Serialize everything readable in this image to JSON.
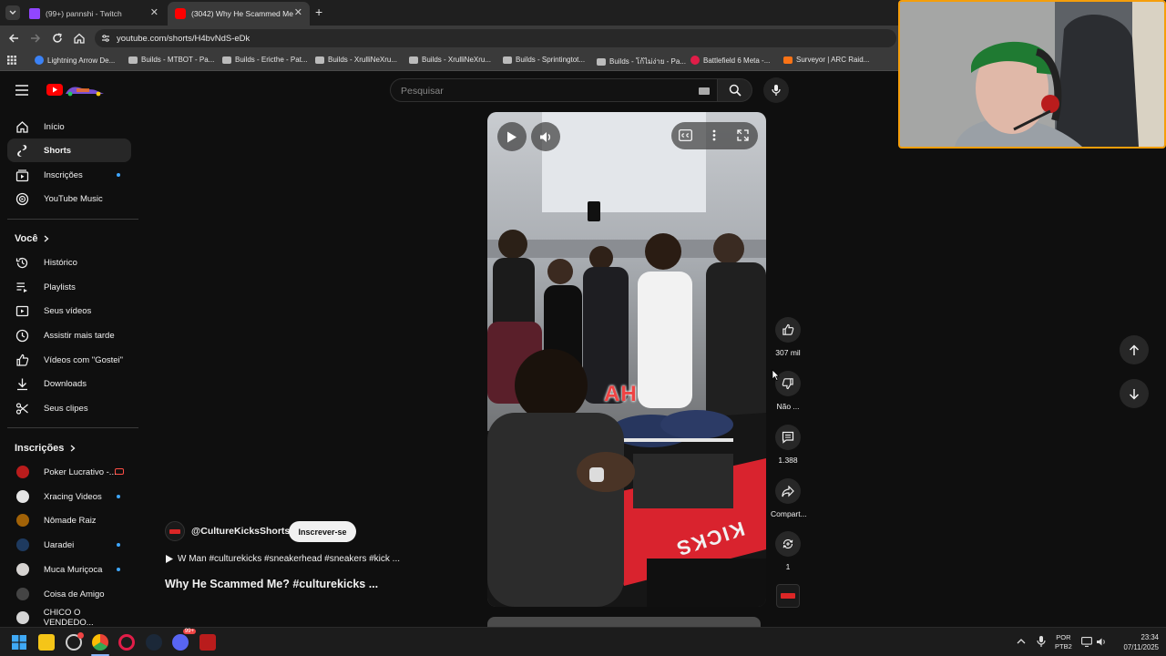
{
  "browser": {
    "tabs": [
      {
        "title": "(99+) pannshi - Twitch"
      },
      {
        "title": "(3042) Why He Scammed Me? #"
      }
    ],
    "url": "youtube.com/shorts/H4bvNdS-eDk",
    "bookmarks": [
      "Lightning Arrow De...",
      "Builds - MTBOT - Pa...",
      "Builds - Ericthe - Pat...",
      "Builds - XrulliNeXru...",
      "Builds - XrulliNeXru...",
      "Builds - Sprintingtot...",
      "Builds - โก้ไม่ง่าย - Pa...",
      "Battlefield 6 Meta -...",
      "Surveyor | ARC Raid..."
    ]
  },
  "youtube": {
    "search_placeholder": "Pesquisar",
    "sidebar": {
      "main": [
        {
          "label": "Início",
          "icon": "home-icon"
        },
        {
          "label": "Shorts",
          "icon": "shorts-icon"
        },
        {
          "label": "Inscrições",
          "icon": "subscriptions-icon"
        },
        {
          "label": "YouTube Music",
          "icon": "music-icon"
        }
      ],
      "you_title": "Você",
      "you": [
        {
          "label": "Histórico"
        },
        {
          "label": "Playlists"
        },
        {
          "label": "Seus vídeos"
        },
        {
          "label": "Assistir mais tarde"
        },
        {
          "label": "Vídeos com \"Gostei\""
        },
        {
          "label": "Downloads"
        },
        {
          "label": "Seus clipes"
        }
      ],
      "subs_title": "Inscrições",
      "subs": [
        {
          "label": "Poker Lucrativo -...",
          "color": "#b91c1c"
        },
        {
          "label": "Xracing Videos",
          "color": "#e5e5e5"
        },
        {
          "label": "Nômade Raiz",
          "color": "#a16207"
        },
        {
          "label": "Uaradei",
          "color": "#1e3a5f"
        },
        {
          "label": "Muca Muriçoca",
          "color": "#d6d3d1"
        },
        {
          "label": "Coisa de Amigo",
          "color": "#444444"
        },
        {
          "label": "CHICO O VENDEDO...",
          "color": "#d4d4d4"
        }
      ]
    },
    "short": {
      "channel": "@CultureKicksShorts",
      "subscribe": "Inscrever-se",
      "description": "W Man #culturekicks  #sneakerhead #sneakers #kick ...",
      "title": "Why He Scammed Me? #culturekicks  ...",
      "caption_overlay": "AH",
      "box_text": "KICKS"
    },
    "actions": {
      "likes": "307 mil",
      "dislike": "Não ...",
      "comments": "1.388",
      "share": "Compart...",
      "remix": "1"
    }
  },
  "taskbar": {
    "lang1": "POR",
    "lang2": "PTB2",
    "time": "23:34",
    "date": "07/11/2025",
    "badge": "99+"
  }
}
